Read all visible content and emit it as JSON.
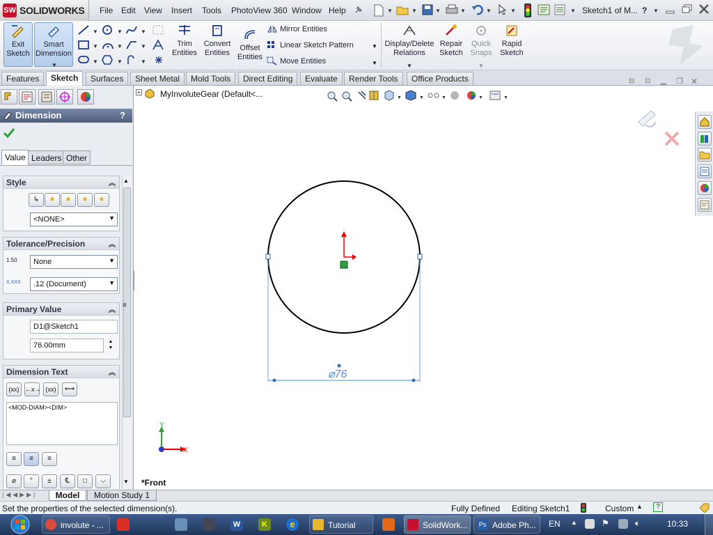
{
  "app": {
    "brand": "SOLIDWORKS",
    "brand_mark": "SW",
    "window_title": "Sketch1 of M..."
  },
  "menu": [
    "File",
    "Edit",
    "View",
    "Insert",
    "Tools",
    "PhotoView 360",
    "Window",
    "Help"
  ],
  "ribbon": {
    "exit_sketch": [
      "Exit",
      "Sketch"
    ],
    "smart_dimension": [
      "Smart",
      "Dimension"
    ],
    "trim": [
      "Trim",
      "Entities"
    ],
    "convert": [
      "Convert",
      "Entities"
    ],
    "offset": [
      "Offset",
      "Entities"
    ],
    "mirror": "Mirror Entities",
    "linear_pattern": "Linear Sketch Pattern",
    "move": "Move Entities",
    "display_delete": [
      "Display/Delete",
      "Relations"
    ],
    "repair": [
      "Repair",
      "Sketch"
    ],
    "quick_snaps": [
      "Quick",
      "Snaps"
    ],
    "rapid": [
      "Rapid",
      "Sketch"
    ]
  },
  "command_tabs": [
    "Features",
    "Sketch",
    "Surfaces",
    "Sheet Metal",
    "Mold Tools",
    "Direct Editing",
    "Evaluate",
    "Render Tools",
    "Office Products"
  ],
  "tree": {
    "item": "MyInvoluteGear  (Default<..."
  },
  "pm": {
    "title": "Dimension",
    "help": "?",
    "subtabs": [
      "Value",
      "Leaders",
      "Other"
    ],
    "style": {
      "title": "Style",
      "select": "<NONE>"
    },
    "tolerance": {
      "title": "Tolerance/Precision",
      "tol_icon": "1.50",
      "tol_select": "None",
      "prec_icon": "X.XXX",
      "prec_select": ".12 (Document)"
    },
    "primary": {
      "title": "Primary Value",
      "name": "D1@Sketch1",
      "value": "76.00mm"
    },
    "dimtext": {
      "title": "Dimension Text",
      "buttons": [
        "(xx)",
        "←x→",
        "(xx)"
      ],
      "text": "<MOD-DIAM><DIM>"
    }
  },
  "canvas": {
    "dimension_label": "⌀76",
    "view_name": "*Front",
    "axis_x": "X",
    "axis_y": "Y"
  },
  "bottom_tabs": [
    "Model",
    "Motion Study 1"
  ],
  "status": {
    "left": "Set the properties of the selected dimension(s).",
    "state": "Fully Defined",
    "editing": "Editing Sketch1",
    "units": "Custom"
  },
  "taskbar": {
    "items": [
      {
        "label": "involute - ...",
        "color": "#dd4b39"
      },
      {
        "label": "Tutorial",
        "color": "#e8b830"
      },
      {
        "label": "SolidWork...",
        "color": "#c8102e"
      },
      {
        "label": "Adobe Ph...",
        "color": "#2a5da8"
      }
    ],
    "lang": "EN",
    "clock": "10:33"
  },
  "colors": {
    "accent": "#4a90d9",
    "brand": "#c8102e",
    "dimension": "#4a90d9",
    "sketch": "#000000"
  }
}
